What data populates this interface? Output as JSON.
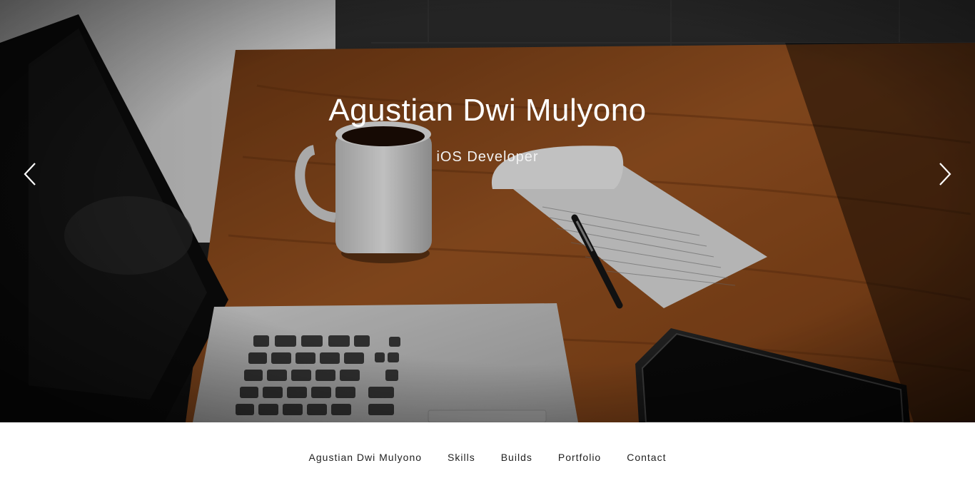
{
  "hero": {
    "title": "Agustian Dwi Mulyono",
    "subtitle": "iOS Developer",
    "prev_icon": "chevron-left-icon",
    "next_icon": "chevron-right-icon"
  },
  "nav": {
    "items": [
      {
        "label": "Agustian Dwi Mulyono"
      },
      {
        "label": "Skills"
      },
      {
        "label": "Builds"
      },
      {
        "label": "Portfolio"
      },
      {
        "label": "Contact"
      }
    ]
  },
  "colors": {
    "hero_text": "#ffffff",
    "nav_text": "#222222",
    "nav_background": "#ffffff",
    "desk_wood": "#8a4a1c"
  }
}
